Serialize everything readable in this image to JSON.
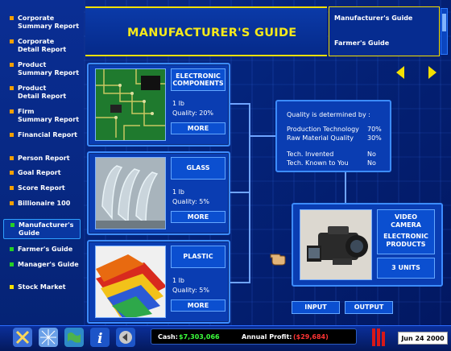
{
  "sidebar": {
    "items": [
      {
        "label": "Corporate Summary Report",
        "line1": "Corporate",
        "line2": "Summary Report",
        "color": "#f4a000"
      },
      {
        "label": "Corporate Detail Report",
        "line1": "Corporate",
        "line2": "Detail Report",
        "color": "#f4a000"
      },
      {
        "label": "Product Summary Report",
        "line1": "Product",
        "line2": "Summary Report",
        "color": "#f4a000"
      },
      {
        "label": "Product Detail Report",
        "line1": "Product",
        "line2": "Detail Report",
        "color": "#f4a000"
      },
      {
        "label": "Firm Summary Report",
        "line1": "Firm",
        "line2": "Summary Report",
        "color": "#f4a000"
      },
      {
        "label": "Financial Report",
        "line1": "Financial Report",
        "line2": "",
        "color": "#f4a000"
      },
      {
        "label": "Person Report",
        "line1": "Person Report",
        "line2": "",
        "color": "#f4a000"
      },
      {
        "label": "Goal Report",
        "line1": "Goal Report",
        "line2": "",
        "color": "#f4a000"
      },
      {
        "label": "Score Report",
        "line1": "Score Report",
        "line2": "",
        "color": "#f4a000"
      },
      {
        "label": "Billionaire 100",
        "line1": "Billionaire 100",
        "line2": "",
        "color": "#f4a000"
      },
      {
        "label": "Manufacturer's Guide",
        "line1": "Manufacturer's",
        "line2": "Guide",
        "color": "#26d026"
      },
      {
        "label": "Farmer's Guide",
        "line1": "Farmer's Guide",
        "line2": "",
        "color": "#26d026"
      },
      {
        "label": "Manager's Guide",
        "line1": "Manager's Guide",
        "line2": "",
        "color": "#26d026"
      },
      {
        "label": "Stock Market",
        "line1": "Stock Market",
        "line2": "",
        "color": "#f4e000"
      }
    ]
  },
  "header": {
    "title": "MANUFACTURER'S GUIDE"
  },
  "guide_menu": {
    "options": [
      "Manufacturer's Guide",
      "Farmer's Guide"
    ]
  },
  "materials": [
    {
      "name_line1": "ELECTRONIC",
      "name_line2": "COMPONENTS",
      "weight": "1 lb",
      "quality": "Quality: 20%",
      "more": "MORE"
    },
    {
      "name_line1": "GLASS",
      "name_line2": "",
      "weight": "1 lb",
      "quality": "Quality: 5%",
      "more": "MORE"
    },
    {
      "name_line1": "PLASTIC",
      "name_line2": "",
      "weight": "1 lb",
      "quality": "Quality: 5%",
      "more": "MORE"
    }
  ],
  "quality_info": {
    "heading": "Quality is determined by :",
    "rows": [
      {
        "label": "Production Technology",
        "value": "70%"
      },
      {
        "label": "Raw Material Quality",
        "value": "30%"
      },
      {
        "label": "Tech. Invented",
        "value": "No"
      },
      {
        "label": "Tech. Known to You",
        "value": "No"
      }
    ]
  },
  "product": {
    "name_line1": "VIDEO",
    "name_line2": "CAMERA",
    "category_line1": "ELECTRONIC",
    "category_line2": "PRODUCTS",
    "units": "3 UNITS"
  },
  "buttons": {
    "input": "INPUT",
    "output": "OUTPUT"
  },
  "status": {
    "cash_label": "Cash:",
    "cash_value": "$7,303,066",
    "profit_label": "Annual Profit:",
    "profit_value": "($29,684)"
  },
  "date": "Jun 24 2000",
  "tool_icons": [
    "tools-icon",
    "map-grid-icon",
    "world-map-icon",
    "info-icon",
    "back-icon"
  ]
}
